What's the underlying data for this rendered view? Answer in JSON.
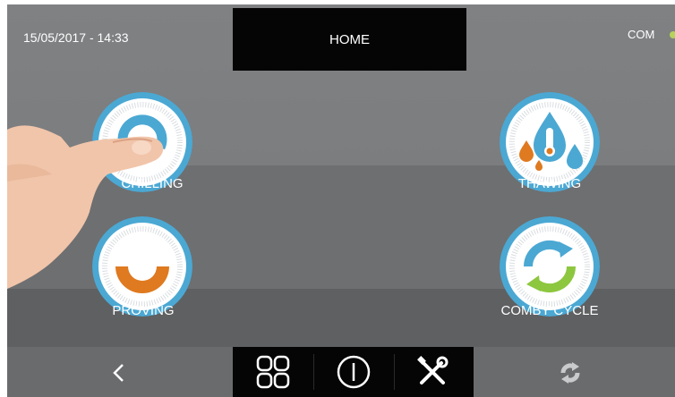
{
  "header": {
    "datetime": "15/05/2017 - 14:33",
    "title": "HOME",
    "status_label": "COM",
    "status_color": "#b6d35b"
  },
  "programs": [
    {
      "id": "chilling",
      "label": "CHILLING",
      "icon": "snowflake-dial-icon"
    },
    {
      "id": "thawing",
      "label": "THAWING",
      "icon": "thermometer-drops-icon"
    },
    {
      "id": "proving",
      "label": "PROVING",
      "icon": "dough-arc-icon"
    },
    {
      "id": "comby",
      "label": "COMBY CYCLE",
      "icon": "cycle-arrows-icon"
    }
  ],
  "footer": {
    "back_icon": "back-chevron-icon",
    "grid_icon": "grid-menu-icon",
    "power_icon": "power-icon",
    "tools_icon": "tools-icon",
    "cycle_icon": "refresh-icon"
  },
  "colors": {
    "accent_blue": "#4aa8d3",
    "proving_orange": "#e07a21",
    "comby_green": "#8dc63f"
  }
}
